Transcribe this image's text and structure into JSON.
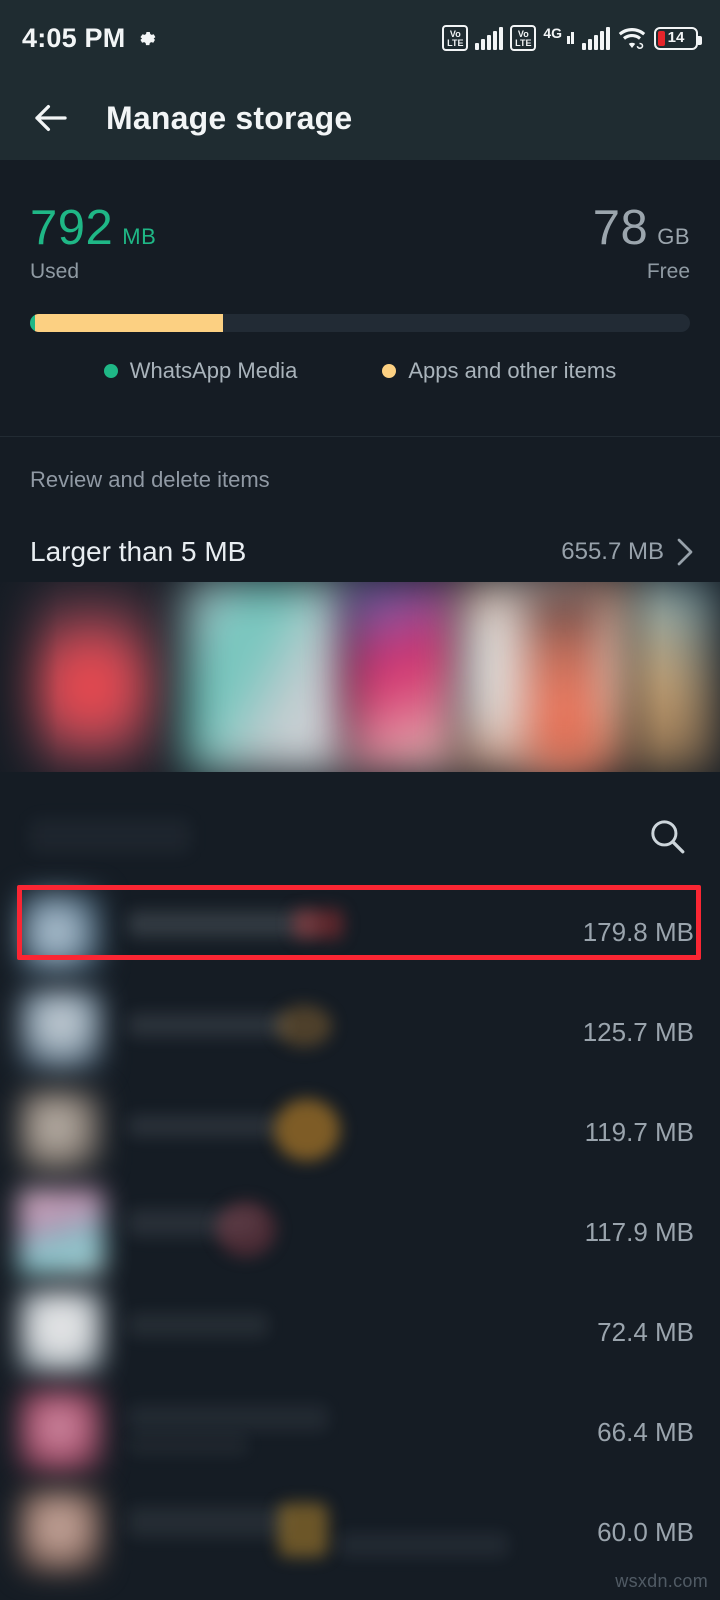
{
  "statusbar": {
    "time": "4:05 PM",
    "gear_icon": "gear-icon",
    "volte_primary": {
      "top": "Vo",
      "bottom": "LTE"
    },
    "volte_secondary": {
      "top": "Vo",
      "bottom": "LTE"
    },
    "network_type": "4G",
    "wifi_icon": "wifi-icon",
    "battery_percent": "14",
    "battery_color": "#e6252b"
  },
  "appbar": {
    "back_icon": "arrow-left-icon",
    "title": "Manage storage"
  },
  "storage": {
    "used": {
      "value": "792",
      "unit": "MB",
      "label": "Used",
      "color": "#1fb786"
    },
    "free": {
      "value": "78",
      "unit": "GB",
      "label": "Free",
      "color": "#9ba5ad"
    },
    "bar": {
      "media_percent": 0.8,
      "apps_percent": 28.5,
      "track_color": "#222b35"
    },
    "legend": [
      {
        "label": "WhatsApp Media",
        "color": "#1fb786",
        "dot": "legend-dot-media"
      },
      {
        "label": "Apps and other items",
        "color": "#fcd082",
        "dot": "legend-dot-apps"
      }
    ]
  },
  "review": {
    "section_title": "Review and delete items",
    "larger_than": {
      "title": "Larger than 5 MB",
      "size": "655.7 MB",
      "chevron_icon": "chevron-right-icon"
    }
  },
  "search": {
    "icon": "search-icon"
  },
  "files": {
    "highlighted_index": 0,
    "highlight_color": "#fa2633",
    "rows": [
      {
        "size": "179.8 MB",
        "thumb": "blurred-media-thumbnail"
      },
      {
        "size": "125.7 MB",
        "thumb": "blurred-media-thumbnail"
      },
      {
        "size": "119.7 MB",
        "thumb": "blurred-media-thumbnail"
      },
      {
        "size": "117.9 MB",
        "thumb": "blurred-media-thumbnail"
      },
      {
        "size": "72.4 MB",
        "thumb": "blurred-media-thumbnail"
      },
      {
        "size": "66.4 MB",
        "thumb": "blurred-media-thumbnail"
      },
      {
        "size": "60.0 MB",
        "thumb": "blurred-media-thumbnail"
      }
    ]
  },
  "watermark": "wsxdn.com"
}
